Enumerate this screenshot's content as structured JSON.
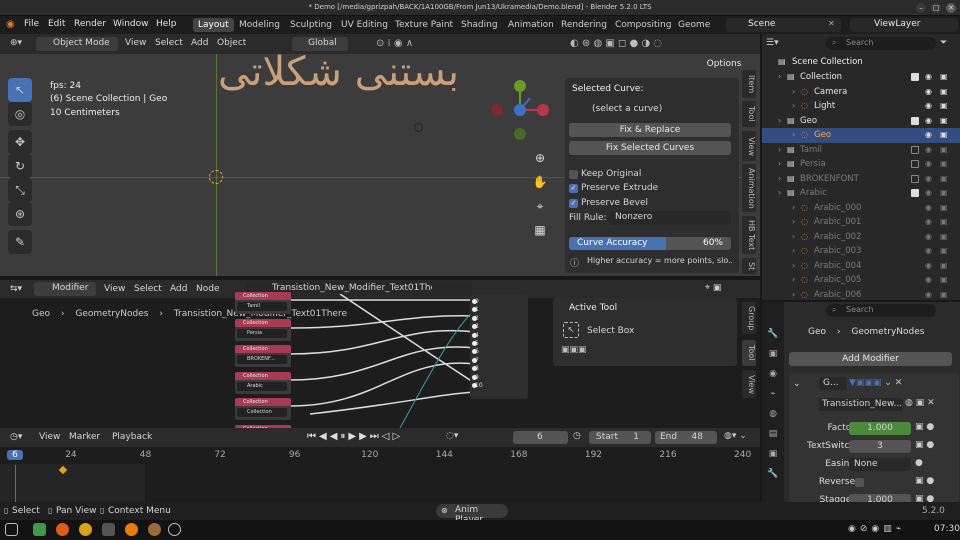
{
  "window": {
    "title": "* Demo [/media/gprizpah/BACK/1A100GB/From Jun13/Ukramedia/Demo.blend] - Blender 5.2.0 LTS",
    "btn_min": "–",
    "btn_max": "□",
    "btn_close": "✕"
  },
  "menus": [
    "File",
    "Edit",
    "Render",
    "Window",
    "Help"
  ],
  "workspaces": [
    "Layout",
    "Modeling",
    "Sculpting",
    "UV Editing",
    "Texture Paint",
    "Shading",
    "Animation",
    "Rendering",
    "Compositing",
    "Geome"
  ],
  "scene": {
    "name": "Scene",
    "viewlayer": "ViewLayer"
  },
  "viewport": {
    "mode": "Object Mode",
    "menus": [
      "View",
      "Select",
      "Add",
      "Object"
    ],
    "orientation": "Global",
    "options": "Options",
    "fps": "fps: 24",
    "collection": "(6) Scene Collection | Geo",
    "scale": "10 Centimeters",
    "arabic_text": "بستنی شکلاتی"
  },
  "npanel": {
    "selected_curve": "Selected Curve:",
    "select_hint": "(select a curve)",
    "fix_replace": "Fix & Replace",
    "fix_selected": "Fix Selected Curves",
    "keep_original": "Keep Original",
    "preserve_extrude": "Preserve Extrude",
    "preserve_bevel": "Preserve Bevel",
    "fill_rule_label": "Fill Rule:",
    "fill_rule_value": "Nonzero",
    "curve_accuracy_label": "Curve Accuracy",
    "curve_accuracy_value": "60%",
    "curve_accuracy": 0.6,
    "hint": "Higher accuracy = more points, slo...",
    "tabs": [
      "Item",
      "Tool",
      "View",
      "Animation",
      "HB Text",
      "St"
    ]
  },
  "outliner": {
    "search": "Search",
    "root": "Scene Collection",
    "rows": [
      {
        "label": "Collection",
        "indent": 1,
        "checked": true
      },
      {
        "label": "Camera",
        "indent": 2
      },
      {
        "label": "Light",
        "indent": 2
      },
      {
        "label": "Geo",
        "indent": 1,
        "checked": true
      },
      {
        "label": "Geo",
        "indent": 2,
        "selected": true
      },
      {
        "label": "Tamil",
        "indent": 1,
        "dim": true
      },
      {
        "label": "Persia",
        "indent": 1,
        "dim": true
      },
      {
        "label": "BROKENFONT",
        "indent": 1,
        "dim": true
      },
      {
        "label": "Arabic",
        "indent": 1,
        "dim": true,
        "checked": true
      },
      {
        "label": "Arabic_000",
        "indent": 2,
        "dim": true
      },
      {
        "label": "Arabic_001",
        "indent": 2,
        "dim": true
      },
      {
        "label": "Arabic_002",
        "indent": 2,
        "dim": true
      },
      {
        "label": "Arabic_003",
        "indent": 2,
        "dim": true
      },
      {
        "label": "Arabic_004",
        "indent": 2,
        "dim": true
      },
      {
        "label": "Arabic_005",
        "indent": 2,
        "dim": true
      },
      {
        "label": "Arabic_006",
        "indent": 2,
        "dim": true
      }
    ]
  },
  "nodeeditor": {
    "editor": "Modifier",
    "menus": [
      "View",
      "Select",
      "Add",
      "Node"
    ],
    "tree_name": "Transistion_New_Modifier_Text01There",
    "breadcrumb": [
      "Geo",
      "GeometryNodes",
      "Transistion_New_Modifier_Text01There"
    ],
    "nodes": [
      {
        "header": "Collection",
        "value": "Tamil"
      },
      {
        "header": "Collection",
        "value": "Persia"
      },
      {
        "header": "Collection",
        "value": "BROKENF..."
      },
      {
        "header": "Collection",
        "value": "Arabic"
      },
      {
        "header": "Collection",
        "value": "Collection"
      },
      {
        "header": "Collection",
        "value": ""
      }
    ],
    "sockets": [
      "0",
      "1",
      "2",
      "3",
      "4",
      "5",
      "6",
      "7",
      "8",
      "9",
      "10"
    ],
    "active_tool_title": "Active Tool",
    "active_tool": "Select Box",
    "side_tabs": [
      "Group",
      "Tool",
      "View"
    ]
  },
  "properties": {
    "search": "Search",
    "breadcrumb": [
      "Geo",
      "GeometryNodes"
    ],
    "add_modifier": "Add Modifier",
    "modifier_short": "G...",
    "node_group": "Transistion_New...",
    "fields": [
      {
        "label": "Factor",
        "value": "1.000",
        "fill": 1
      },
      {
        "label": "TextSwitch",
        "value": "3"
      },
      {
        "label": "Easing",
        "value": "None"
      },
      {
        "label": "Reverse",
        "value": ""
      },
      {
        "label": "Stagger",
        "value": "1.000"
      }
    ]
  },
  "timeline": {
    "menus": [
      "View",
      "Marker",
      "Playback"
    ],
    "current": "6",
    "start_label": "Start",
    "start": "1",
    "end_label": "End",
    "end": "48",
    "ticks": [
      "6",
      "24",
      "48",
      "72",
      "96",
      "120",
      "144",
      "168",
      "192",
      "216",
      "240"
    ],
    "current_frame": 6,
    "frame_min": 0,
    "frame_max": 240
  },
  "status": {
    "select": "Select",
    "pan": "Pan View",
    "ctx": "Context Menu",
    "center": "Anim Player",
    "version": "5.2.0"
  },
  "taskbar": {
    "clock": "07:30"
  }
}
